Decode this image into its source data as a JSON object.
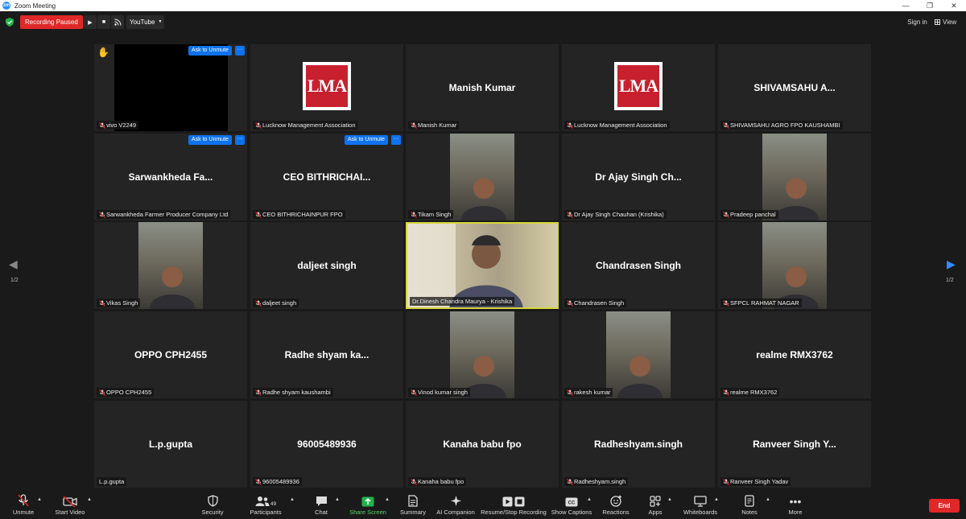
{
  "window": {
    "title": "Zoom Meeting",
    "logo_text": "zm"
  },
  "topbar": {
    "recording_label": "Recording Paused",
    "play_icon": "play-icon",
    "stop_icon": "stop-icon",
    "stream_icon": "broadcast-icon",
    "stream_target": "YouTube",
    "sign_in": "Sign in",
    "view": "View"
  },
  "participants": [
    {
      "name": "vivo V2249",
      "display": "",
      "muted": true,
      "hand": "✋",
      "ask_unmute": "Ask to Unmute",
      "video": "black"
    },
    {
      "name": "Lucknow Management Association",
      "display": "",
      "muted": true,
      "video": "lma",
      "logo_text": "LMA"
    },
    {
      "name": "Manish Kumar",
      "display": "Manish Kumar",
      "muted": true
    },
    {
      "name": "Lucknow Management Association",
      "display": "",
      "muted": true,
      "video": "lma",
      "logo_text": "LMA"
    },
    {
      "name": "SHIVAMSAHU AGRO FPO KAUSHAMBI",
      "display": "SHIVAMSAHU  A...",
      "muted": true
    },
    {
      "name": "Sarwankheda Farmer Producer Company Ltd",
      "display": "Sarwankheda  Fa...",
      "muted": true,
      "ask_unmute": "Ask to Unmute"
    },
    {
      "name": "CEO BITHRICHAINPUR FPO",
      "display": "CEO  BITHRICHAI...",
      "muted": true,
      "ask_unmute": "Ask to Unmute"
    },
    {
      "name": "Tikam Singh",
      "display": "",
      "muted": true,
      "video": "person"
    },
    {
      "name": "Dr Ajay Singh Chauhan (Krishika)",
      "display": "Dr Ajay Singh Ch...",
      "muted": true
    },
    {
      "name": "Pradeep panchal",
      "display": "",
      "muted": true,
      "video": "person"
    },
    {
      "name": "Vikas Singh",
      "display": "",
      "muted": true,
      "video": "person"
    },
    {
      "name": "daljeet singh",
      "display": "daljeet singh",
      "muted": true
    },
    {
      "name": "Dr.Dinesh Chandra Maurya - Krishika",
      "display": "",
      "muted": false,
      "video": "speaker",
      "active": true
    },
    {
      "name": "Chandrasen Singh",
      "display": "Chandrasen Singh",
      "muted": true
    },
    {
      "name": "SFPCL RAHMAT NAGAR",
      "display": "",
      "muted": true,
      "video": "person"
    },
    {
      "name": "OPPO CPH2455",
      "display": "OPPO CPH2455",
      "muted": true
    },
    {
      "name": "Radhe shyam kaushambi",
      "display": "Radhe  shyam  ka...",
      "muted": true
    },
    {
      "name": "Vinod kumar singh",
      "display": "",
      "muted": true,
      "video": "person"
    },
    {
      "name": "rakesh kumar",
      "display": "",
      "muted": true,
      "video": "person"
    },
    {
      "name": "realme RMX3762",
      "display": "realme RMX3762",
      "muted": true
    },
    {
      "name": "L.p.gupta",
      "display": "L.p.gupta",
      "muted": false
    },
    {
      "name": "96005489936",
      "display": "96005489936",
      "muted": true
    },
    {
      "name": "Kanaha babu fpo",
      "display": "Kanaha babu fpo",
      "muted": true
    },
    {
      "name": "Radheshyam.singh",
      "display": "Radheshyam.singh",
      "muted": true
    },
    {
      "name": "Ranveer Singh Yadav",
      "display": "Ranveer Singh Y...",
      "muted": true
    }
  ],
  "paging": {
    "left": "1/2",
    "right": "1/2"
  },
  "toolbar": {
    "unmute": "Unmute",
    "start_video": "Start Video",
    "security": "Security",
    "participants": "Participants",
    "participants_count": "49",
    "chat": "Chat",
    "share_screen": "Share Screen",
    "summary": "Summary",
    "ai_companion": "AI Companion",
    "resume_stop_recording": "Resume/Stop Recording",
    "show_captions": "Show Captions",
    "reactions": "Reactions",
    "apps": "Apps",
    "whiteboards": "Whiteboards",
    "notes": "Notes",
    "more": "More",
    "end": "End"
  },
  "colors": {
    "accent_blue": "#0e72ed",
    "end_red": "#e02828",
    "active_speaker": "#d6d63a",
    "share_green": "#5cd66a"
  }
}
